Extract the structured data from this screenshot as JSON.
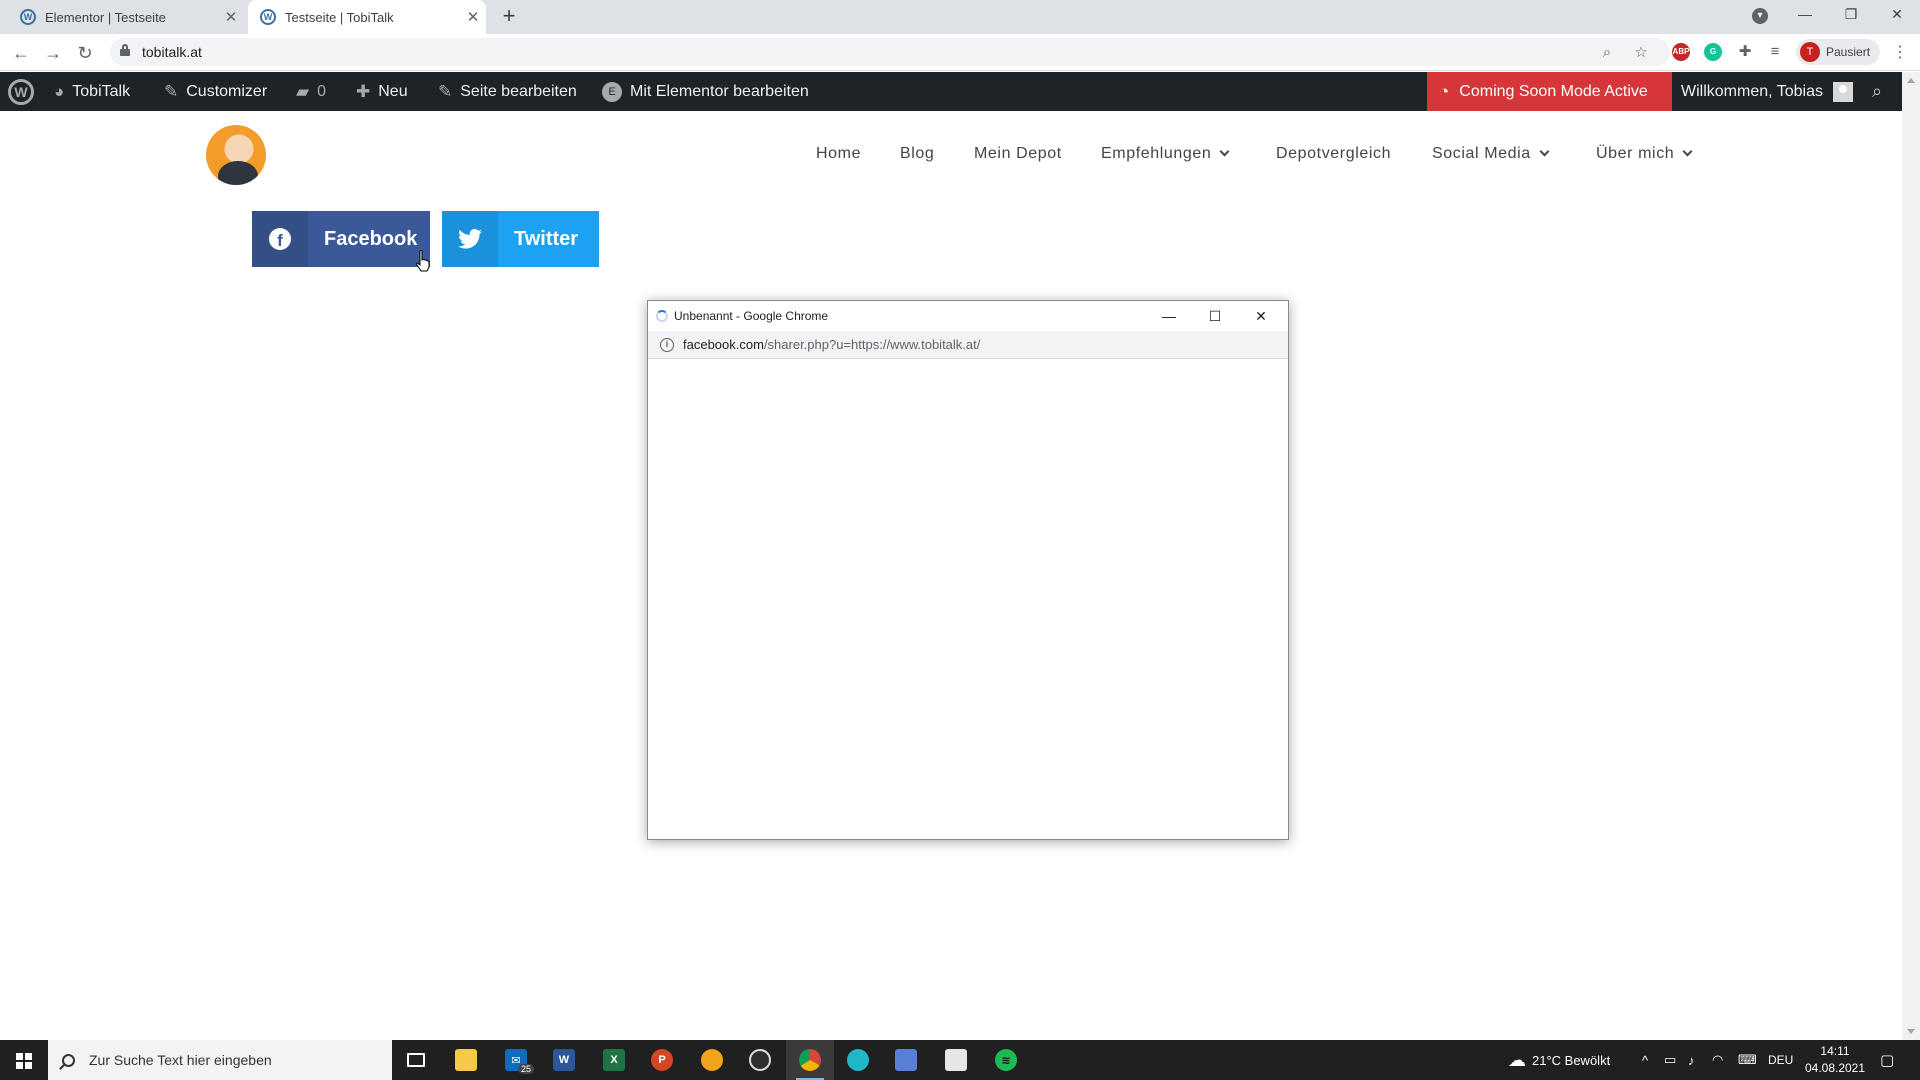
{
  "browser": {
    "tabs": [
      {
        "title": "Elementor | Testseite",
        "active": false
      },
      {
        "title": "Testseite | TobiTalk",
        "active": true
      }
    ],
    "url": "tobitalk.at",
    "profile_label": "Pausiert",
    "profile_initial": "T"
  },
  "adminbar": {
    "site_name": "TobiTalk",
    "customizer": "Customizer",
    "comments_count": "0",
    "new_label": "Neu",
    "edit_page": "Seite bearbeiten",
    "edit_elementor": "Mit Elementor bearbeiten",
    "coming_soon": "Coming Soon Mode Active",
    "welcome": "Willkommen, Tobias"
  },
  "nav": {
    "items": [
      "Home",
      "Blog",
      "Mein Depot",
      "Empfehlungen",
      "Depotvergleich",
      "Social Media",
      "Über mich"
    ]
  },
  "share": {
    "facebook_label": "Facebook",
    "twitter_label": "Twitter",
    "facebook_color": "#3b5998",
    "twitter_color": "#1da1f2"
  },
  "popup": {
    "title": "Unbenannt - Google Chrome",
    "url_host": "facebook.com",
    "url_path": "/sharer.php?u=https://www.tobitalk.at/"
  },
  "taskbar": {
    "search_placeholder": "Zur Suche Text hier eingeben",
    "mail_badge": "25",
    "weather": "21°C  Bewölkt",
    "language": "DEU",
    "time": "14:11",
    "date": "04.08.2021"
  }
}
